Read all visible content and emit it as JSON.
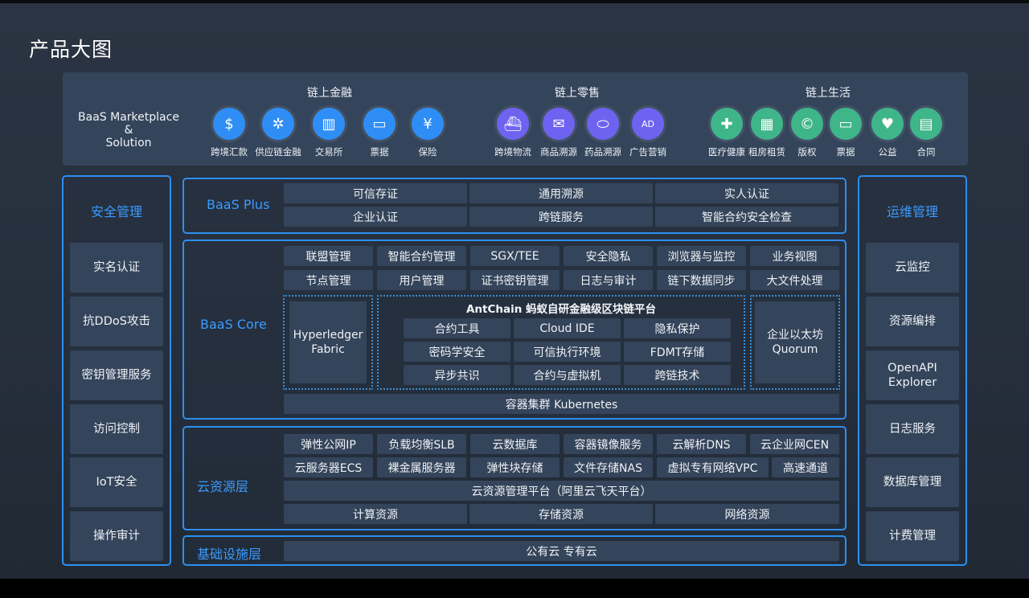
{
  "title": "产品大图",
  "marketplace": {
    "line1": "BaaS Marketplace",
    "line2": "&",
    "line3": "Solution"
  },
  "groups": {
    "finance": {
      "title": "链上金融",
      "items": [
        {
          "label": "跨境汇款",
          "icon": "dollar-coin-icon"
        },
        {
          "label": "供应链金融",
          "icon": "network-icon"
        },
        {
          "label": "交易所",
          "icon": "bar-chart-icon"
        },
        {
          "label": "票据",
          "icon": "ticket-icon"
        },
        {
          "label": "保险",
          "icon": "yen-shield-icon"
        }
      ]
    },
    "retail": {
      "title": "链上零售",
      "items": [
        {
          "label": "跨境物流",
          "icon": "ship-icon"
        },
        {
          "label": "商品溯源",
          "icon": "mail-search-icon"
        },
        {
          "label": "药品溯源",
          "icon": "capsule-icon"
        },
        {
          "label": "广告营销",
          "icon": "ad-icon"
        }
      ]
    },
    "life": {
      "title": "链上生活",
      "items": [
        {
          "label": "医疗健康",
          "icon": "medical-kit-icon"
        },
        {
          "label": "租房租赁",
          "icon": "building-icon"
        },
        {
          "label": "版权",
          "icon": "copyright-icon"
        },
        {
          "label": "票据",
          "icon": "ticket-icon"
        },
        {
          "label": "公益",
          "icon": "heart-hands-icon"
        },
        {
          "label": "合同",
          "icon": "contract-icon"
        }
      ]
    }
  },
  "security": {
    "title": "安全管理",
    "items": [
      "实名认证",
      "抗DDoS攻击",
      "密钥管理服务",
      "访问控制",
      "IoT安全",
      "操作审计"
    ]
  },
  "ops": {
    "title": "运维管理",
    "items": [
      "云监控",
      "资源编排",
      "OpenAPI Explorer",
      "日志服务",
      "数据库管理",
      "计费管理"
    ]
  },
  "baas_plus": {
    "label": "BaaS Plus",
    "rows": [
      [
        "可信存证",
        "通用溯源",
        "实人认证"
      ],
      [
        "企业认证",
        "跨链服务",
        "智能合约安全检查"
      ]
    ]
  },
  "baas_core": {
    "label": "BaaS Core",
    "rows": [
      [
        "联盟管理",
        "智能合约管理",
        "SGX/TEE",
        "安全隐私",
        "浏览器与监控",
        "业务视图"
      ],
      [
        "节点管理",
        "用户管理",
        "证书密钥管理",
        "日志与审计",
        "链下数据同步",
        "大文件处理"
      ]
    ],
    "hyperledger": "Hyperledger Fabric",
    "antchain_title": "AntChain 蚂蚁自研金融级区块链平台",
    "antchain_rows": [
      [
        "合约工具",
        "Cloud IDE",
        "隐私保护"
      ],
      [
        "密码学安全",
        "可信执行环境",
        "FDMT存储"
      ],
      [
        "异步共识",
        "合约与虚拟机",
        "跨链技术"
      ]
    ],
    "quorum": "企业以太坊 Quorum",
    "kubernetes": "容器集群 Kubernetes"
  },
  "cloud": {
    "label": "云资源层",
    "rows": [
      [
        "弹性公网IP",
        "负载均衡SLB",
        "云数据库",
        "容器镜像服务",
        "云解析DNS",
        "云企业网CEN"
      ],
      [
        "云服务器ECS",
        "裸金属服务器",
        "弹性块存储",
        "文件存储NAS",
        "虚拟专有网络VPC",
        "高速通道"
      ]
    ],
    "platform": "云资源管理平台（阿里云飞天平台）",
    "resources": [
      "计算资源",
      "存储资源",
      "网络资源"
    ]
  },
  "infra": {
    "label": "基础设施层",
    "value": "公有云 专有云"
  },
  "colors": {
    "accent": "#2d8ff0",
    "cell": "#34445a",
    "finance": "#2f8ef5",
    "retail": "#6e63f0",
    "life": "#3fb58a"
  }
}
